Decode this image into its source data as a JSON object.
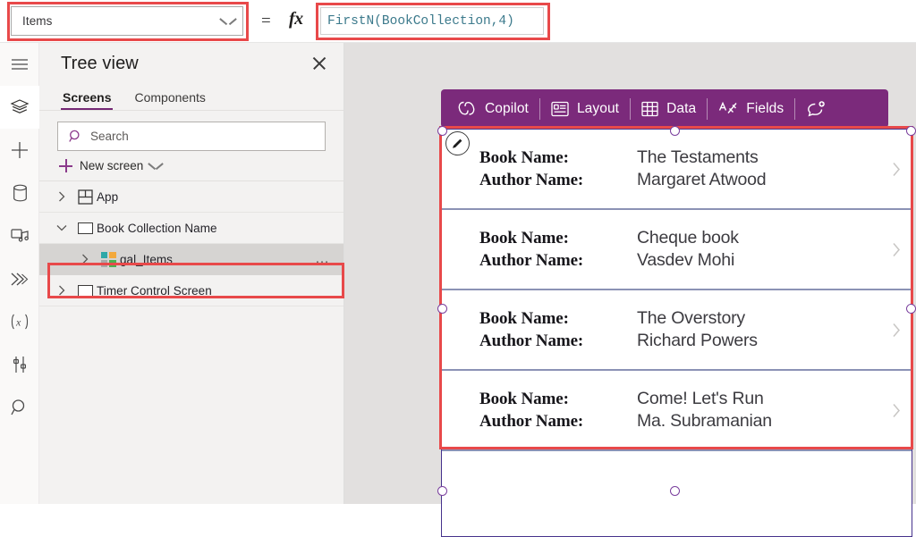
{
  "formula_bar": {
    "property_selected": "Items",
    "equals": "=",
    "fx": "fx",
    "formula": "FirstN(BookCollection,4)",
    "formula_color": "#3c7a8c"
  },
  "left_rail": {
    "items": [
      {
        "name": "hamburger-menu-icon",
        "active": false
      },
      {
        "name": "tree-view-icon",
        "active": true
      },
      {
        "name": "insert-icon",
        "active": false
      },
      {
        "name": "data-icon",
        "active": false
      },
      {
        "name": "media-icon",
        "active": false
      },
      {
        "name": "power-automate-icon",
        "active": false
      },
      {
        "name": "variables-icon",
        "active": false
      },
      {
        "name": "tools-icon",
        "active": false
      },
      {
        "name": "search-rail-icon",
        "active": false
      }
    ]
  },
  "tree_panel": {
    "title": "Tree view",
    "close_label": "Close",
    "tabs": [
      {
        "label": "Screens",
        "selected": true
      },
      {
        "label": "Components",
        "selected": false
      }
    ],
    "search": {
      "placeholder": "Search",
      "value": ""
    },
    "new_screen": {
      "label": "New screen"
    },
    "rows": [
      {
        "label": "App",
        "icon": "app-icon",
        "indent": 0,
        "expanded": false,
        "selected": false,
        "ellipsis": false
      },
      {
        "label": "Book Collection Name",
        "icon": "screen-icon",
        "indent": 1,
        "expanded": true,
        "selected": false,
        "ellipsis": false
      },
      {
        "label": "gal_Items",
        "icon": "gallery-icon",
        "indent": 2,
        "expanded": false,
        "selected": true,
        "ellipsis": true
      },
      {
        "label": "Timer Control Screen",
        "icon": "screen-icon",
        "indent": 1,
        "expanded": false,
        "selected": false,
        "ellipsis": false
      }
    ]
  },
  "canvas": {
    "toolbar": {
      "background": "#7b2a7b",
      "items": [
        {
          "label": "Copilot",
          "icon": "copilot-icon"
        },
        {
          "label": "Layout",
          "icon": "layout-icon"
        },
        {
          "label": "Data",
          "icon": "data-grid-icon"
        },
        {
          "label": "Fields",
          "icon": "fields-icon"
        }
      ],
      "feedback_icon": "add-comment-icon"
    },
    "gallery": {
      "name": "gal_Items",
      "border_color": "#46328c",
      "book_label": "Book Name:",
      "author_label": "Author Name:",
      "rows": [
        {
          "book": "The Testaments",
          "author": "Margaret Atwood"
        },
        {
          "book": "Cheque book",
          "author": "Vasdev Mohi"
        },
        {
          "book": "The Overstory",
          "author": "Richard Powers"
        },
        {
          "book": "Come! Let's Run",
          "author": "Ma. Subramanian"
        }
      ],
      "edit_badge_icon": "pencil-edit-icon"
    }
  },
  "annotations": {
    "color": "#e8494a",
    "boxes": [
      {
        "name": "property-dropdown-highlight"
      },
      {
        "name": "formula-input-highlight"
      },
      {
        "name": "gal-items-row-highlight"
      },
      {
        "name": "gallery-canvas-highlight"
      }
    ]
  }
}
